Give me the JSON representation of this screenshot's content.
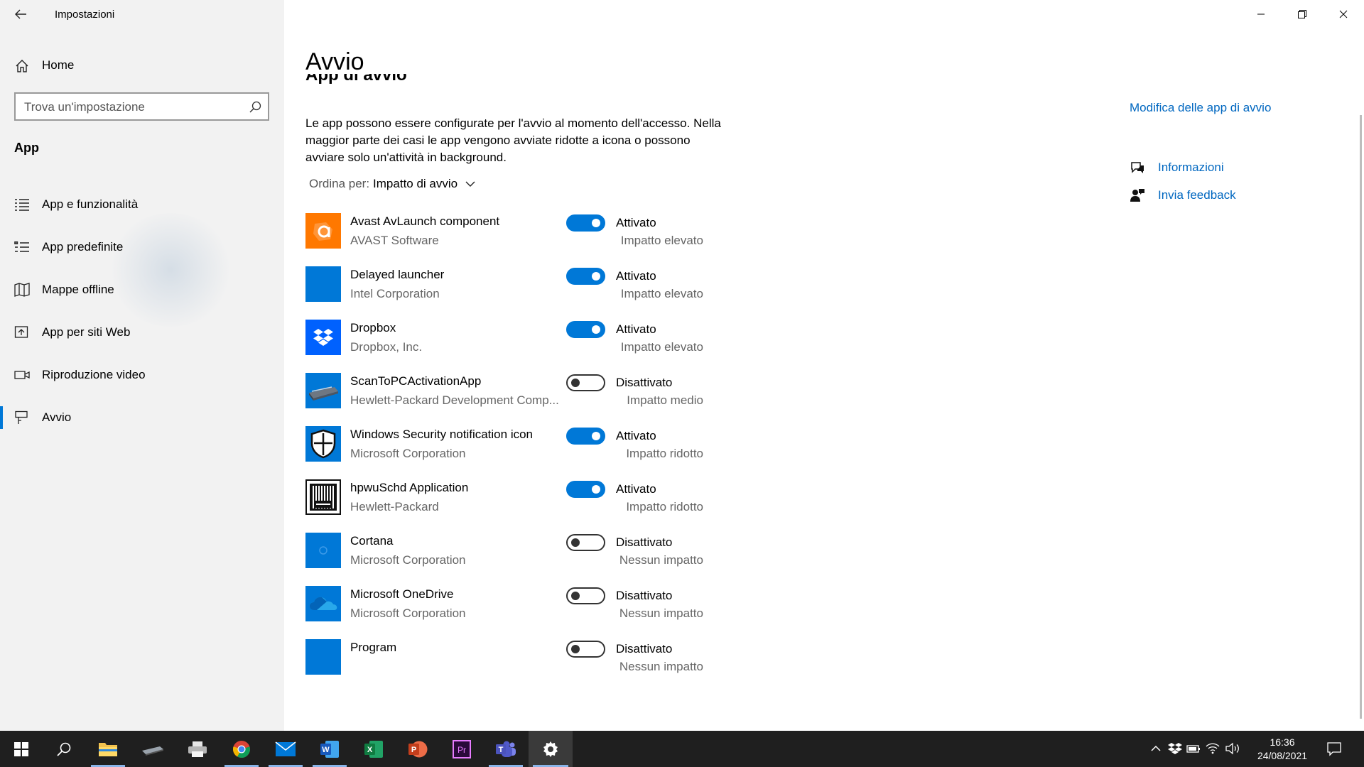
{
  "window": {
    "title": "Impostazioni"
  },
  "sidebar": {
    "home_label": "Home",
    "search_placeholder": "Trova un'impostazione",
    "section_label": "App",
    "items": [
      {
        "label": "App e funzionalità",
        "icon": "list-icon"
      },
      {
        "label": "App predefinite",
        "icon": "default-apps-icon"
      },
      {
        "label": "Mappe offline",
        "icon": "map-icon"
      },
      {
        "label": "App per siti Web",
        "icon": "web-app-icon"
      },
      {
        "label": "Riproduzione video",
        "icon": "video-icon"
      },
      {
        "label": "Avvio",
        "icon": "startup-icon",
        "active": true
      }
    ]
  },
  "main": {
    "title": "Avvio",
    "subtitle": "App di avvio",
    "description": "Le app possono essere configurate per l'avvio al momento dell'accesso. Nella maggior parte dei casi le app vengono avviate ridotte a icona o possono avviare solo un'attività in background.",
    "sort_label": "Ordina per:",
    "sort_value": "Impatto di avvio",
    "apps": [
      {
        "name": "Avast AvLaunch component",
        "publisher": "AVAST Software",
        "on": true,
        "state": "Attivato",
        "impact": "Impatto elevato",
        "icon": "avast-icon"
      },
      {
        "name": "Delayed launcher",
        "publisher": "Intel Corporation",
        "on": true,
        "state": "Attivato",
        "impact": "Impatto elevato",
        "icon": "generic-app-icon"
      },
      {
        "name": "Dropbox",
        "publisher": "Dropbox, Inc.",
        "on": true,
        "state": "Attivato",
        "impact": "Impatto elevato",
        "icon": "dropbox-icon"
      },
      {
        "name": "ScanToPCActivationApp",
        "publisher": "Hewlett-Packard Development Comp...",
        "on": false,
        "state": "Disattivato",
        "impact": "Impatto medio",
        "icon": "scanner-icon"
      },
      {
        "name": "Windows Security notification icon",
        "publisher": "Microsoft Corporation",
        "on": true,
        "state": "Attivato",
        "impact": "Impatto ridotto",
        "icon": "shield-icon"
      },
      {
        "name": "hpwuSchd Application",
        "publisher": "Hewlett-Packard",
        "on": true,
        "state": "Attivato",
        "impact": "Impatto ridotto",
        "icon": "barcode-icon"
      },
      {
        "name": "Cortana",
        "publisher": "Microsoft Corporation",
        "on": false,
        "state": "Disattivato",
        "impact": "Nessun impatto",
        "icon": "cortana-icon"
      },
      {
        "name": "Microsoft OneDrive",
        "publisher": "Microsoft Corporation",
        "on": false,
        "state": "Disattivato",
        "impact": "Nessun impatto",
        "icon": "onedrive-icon"
      },
      {
        "name": "Program",
        "publisher": "",
        "on": false,
        "state": "Disattivato",
        "impact": "Nessun impatto",
        "icon": "generic-app-icon"
      }
    ]
  },
  "right_panel": {
    "main_link": "Modifica delle app di avvio",
    "info_link": "Informazioni",
    "feedback_link": "Invia feedback"
  },
  "taskbar": {
    "apps": [
      "start-icon",
      "search-icon",
      "file-explorer-icon",
      "scanner-app-icon",
      "printer-icon",
      "chrome-icon",
      "mail-icon",
      "word-icon",
      "excel-icon",
      "powerpoint-icon",
      "premiere-icon",
      "teams-icon",
      "settings-icon"
    ],
    "time": "16:36",
    "date": "24/08/2021"
  },
  "colors": {
    "accent": "#0078d7",
    "link": "#0067c0",
    "sidebar_bg": "#f2f2f2",
    "taskbar_bg": "#1f1f1f"
  }
}
